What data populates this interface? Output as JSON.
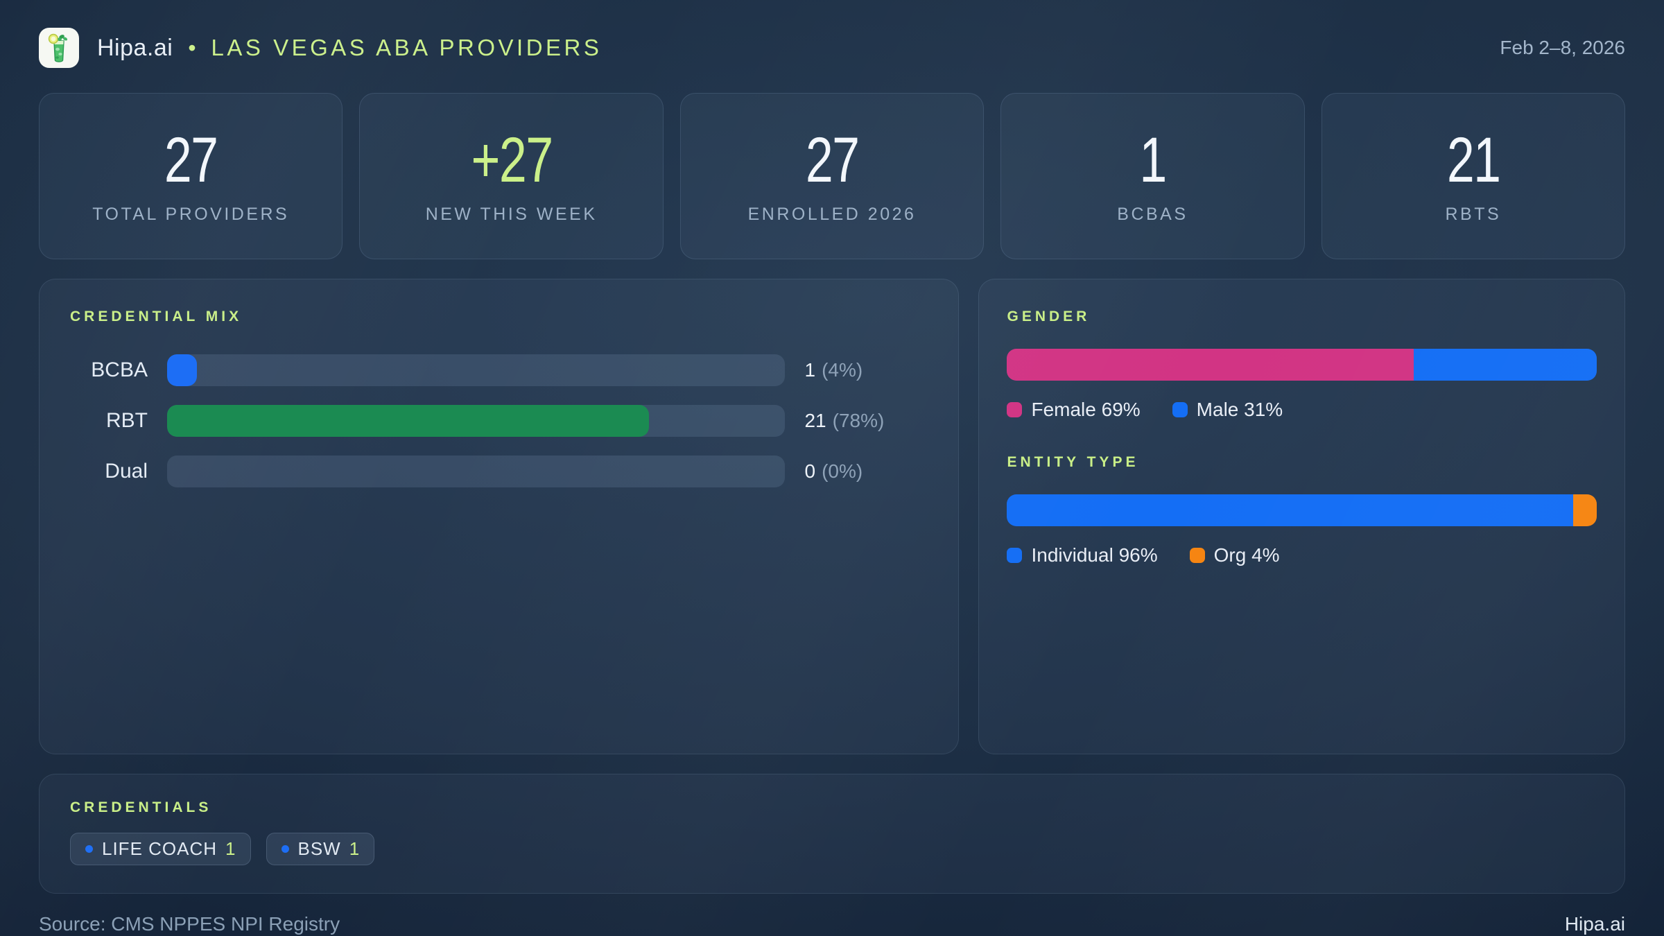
{
  "header": {
    "brand": "Hipa.ai",
    "separator": "•",
    "title": "LAS VEGAS ABA PROVIDERS",
    "date_range": "Feb 2–8, 2026",
    "logo_icon": "mojito-drink-icon"
  },
  "stats": [
    {
      "value": "27",
      "label": "TOTAL PROVIDERS"
    },
    {
      "value": "+27",
      "label": "NEW THIS WEEK"
    },
    {
      "value": "27",
      "label": "ENROLLED 2026"
    },
    {
      "value": "1",
      "label": "BCBAS"
    },
    {
      "value": "21",
      "label": "RBTS"
    }
  ],
  "credential_mix": {
    "title": "CREDENTIAL MIX",
    "rows": [
      {
        "label": "BCBA",
        "count": "1",
        "pct_text": "(4%)",
        "fill": {
          "pct": 4.8,
          "color": "#1d6ef5"
        }
      },
      {
        "label": "RBT",
        "count": "21",
        "pct_text": "(78%)",
        "fill": {
          "pct": 78,
          "color": "#1b8b52"
        }
      },
      {
        "label": "Dual",
        "count": "0",
        "pct_text": "(0%)",
        "fill": {
          "pct": 0,
          "color": "transparent"
        }
      }
    ]
  },
  "gender": {
    "title": "GENDER",
    "segments": [
      {
        "name": "Female",
        "pct": 69,
        "color": "#d23484"
      },
      {
        "name": "Male",
        "pct": 31,
        "color": "#146ef5"
      }
    ],
    "legend": [
      {
        "text": "Female 69%",
        "color": "#d23484"
      },
      {
        "text": "Male 31%",
        "color": "#146ef5"
      }
    ]
  },
  "entity_type": {
    "title": "ENTITY TYPE",
    "segments": [
      {
        "name": "Individual",
        "pct": 96,
        "color": "#146ef5"
      },
      {
        "name": "Org",
        "pct": 4,
        "color": "#f68511"
      }
    ],
    "legend": [
      {
        "text": "Individual 96%",
        "color": "#146ef5"
      },
      {
        "text": "Org 4%",
        "color": "#f68511"
      }
    ]
  },
  "credentials": {
    "title": "CREDENTIALS",
    "chips": [
      {
        "label": "LIFE COACH",
        "count": "1",
        "dot_color": "#1d6ef5"
      },
      {
        "label": "BSW",
        "count": "1",
        "dot_color": "#1d6ef5"
      }
    ]
  },
  "footer": {
    "source": "Source: CMS NPPES NPI Registry",
    "brand": "Hipa.ai"
  },
  "accent_colors": {
    "lime": "#cbf08a",
    "blue": "#1d6ef5",
    "green": "#1b8b52",
    "pink": "#d23484",
    "orange": "#f68511"
  },
  "chart_data": [
    {
      "type": "bar",
      "orientation": "horizontal",
      "title": "CREDENTIAL MIX",
      "categories": [
        "BCBA",
        "RBT",
        "Dual"
      ],
      "values": [
        1,
        21,
        0
      ],
      "percentages": [
        4,
        78,
        0
      ],
      "value_labels": [
        "1 (4%)",
        "21 (78%)",
        "0 (0%)"
      ],
      "colors": [
        "#1d6ef5",
        "#1b8b52",
        "none"
      ],
      "xlim": [
        0,
        27
      ],
      "grid": false
    },
    {
      "type": "bar",
      "subtype": "stacked-percent",
      "title": "GENDER",
      "categories": [
        "Female",
        "Male"
      ],
      "values": [
        69,
        31
      ],
      "unit": "%",
      "colors": [
        "#d23484",
        "#146ef5"
      ],
      "legend_position": "bottom"
    },
    {
      "type": "bar",
      "subtype": "stacked-percent",
      "title": "ENTITY TYPE",
      "categories": [
        "Individual",
        "Org"
      ],
      "values": [
        96,
        4
      ],
      "unit": "%",
      "colors": [
        "#146ef5",
        "#f68511"
      ],
      "legend_position": "bottom"
    }
  ]
}
